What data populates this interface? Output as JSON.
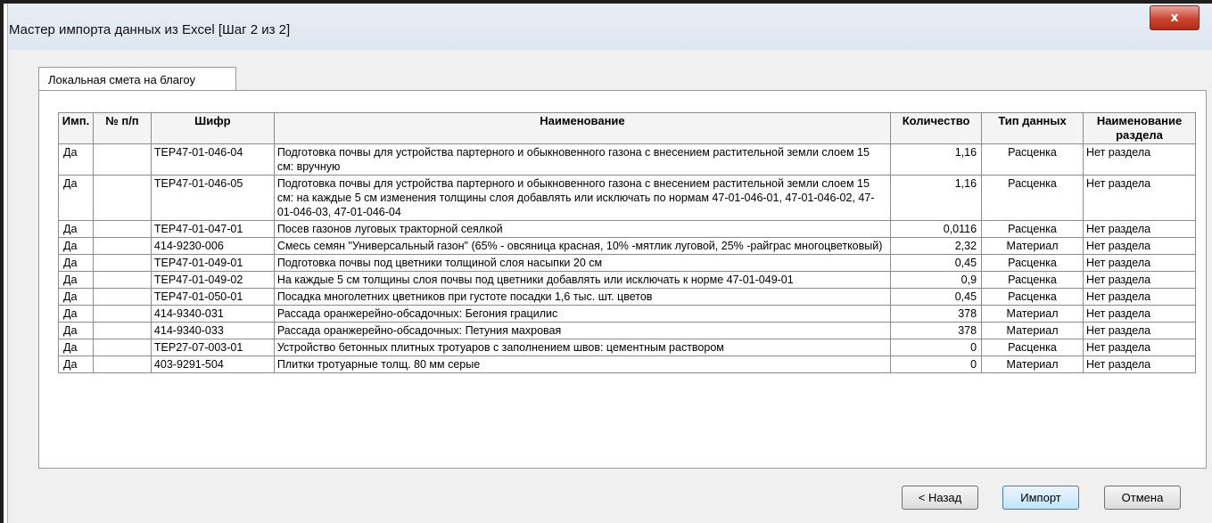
{
  "window": {
    "title": "Мастер импорта данных из Excel [Шаг 2 из 2]",
    "close_label": "x"
  },
  "tab": {
    "label": "Локальная смета на благоу"
  },
  "table": {
    "headers": {
      "imp": "Имп.",
      "num": "№ п/п",
      "code": "Шифр",
      "name": "Наименование",
      "qty": "Количество",
      "type": "Тип данных",
      "section": "Наименование раздела"
    },
    "rows": [
      {
        "imp": "Да",
        "num": "",
        "code": "ТЕР47-01-046-04",
        "name": "Подготовка почвы для устройства партерного и обыкновенного газона с внесением растительной земли слоем 15 см: вручную",
        "qty": "1,16",
        "type": "Расценка",
        "section": "Нет раздела"
      },
      {
        "imp": "Да",
        "num": "",
        "code": "ТЕР47-01-046-05",
        "name": "Подготовка почвы для устройства партерного и обыкновенного газона с внесением растительной земли слоем 15 см: на каждые 5 см изменения толщины слоя добавлять или исключать по нормам 47-01-046-01, 47-01-046-02, 47-01-046-03, 47-01-046-04",
        "qty": "1,16",
        "type": "Расценка",
        "section": "Нет раздела"
      },
      {
        "imp": "Да",
        "num": "",
        "code": "ТЕР47-01-047-01",
        "name": "Посев газонов луговых тракторной сеялкой",
        "qty": "0,0116",
        "type": "Расценка",
        "section": "Нет раздела"
      },
      {
        "imp": "Да",
        "num": "",
        "code": "414-9230-006",
        "name": "Смесь семян \"Универсальный газон\" (65% - овсяница красная, 10% -мятлик луговой, 25% -райграс многоцветковый)",
        "qty": "2,32",
        "type": "Материал",
        "section": "Нет раздела"
      },
      {
        "imp": "Да",
        "num": "",
        "code": "ТЕР47-01-049-01",
        "name": "Подготовка почвы под цветники толщиной слоя насыпки 20 см",
        "qty": "0,45",
        "type": "Расценка",
        "section": "Нет раздела"
      },
      {
        "imp": "Да",
        "num": "",
        "code": "ТЕР47-01-049-02",
        "name": "На каждые 5 см толщины слоя почвы под цветники добавлять или исключать к норме 47-01-049-01",
        "qty": "0,9",
        "type": "Расценка",
        "section": "Нет раздела"
      },
      {
        "imp": "Да",
        "num": "",
        "code": "ТЕР47-01-050-01",
        "name": "Посадка многолетних цветников при густоте посадки 1,6 тыс. шт. цветов",
        "qty": "0,45",
        "type": "Расценка",
        "section": "Нет раздела"
      },
      {
        "imp": "Да",
        "num": "",
        "code": "414-9340-031",
        "name": "Рассада оранжерейно-обсадочных: Бегония грацилис",
        "qty": "378",
        "type": "Материал",
        "section": "Нет раздела"
      },
      {
        "imp": "Да",
        "num": "",
        "code": "414-9340-033",
        "name": "Рассада оранжерейно-обсадочных: Петуния махровая",
        "qty": "378",
        "type": "Материал",
        "section": "Нет раздела"
      },
      {
        "imp": "Да",
        "num": "",
        "code": "ТЕР27-07-003-01",
        "name": "Устройство бетонных плитных тротуаров с заполнением швов: цементным раствором",
        "qty": "0",
        "type": "Расценка",
        "section": "Нет раздела"
      },
      {
        "imp": "Да",
        "num": "",
        "code": "403-9291-504",
        "name": "Плитки тротуарные толщ. 80 мм серые",
        "qty": "0",
        "type": "Материал",
        "section": "Нет раздела"
      }
    ]
  },
  "buttons": {
    "back": "< Назад",
    "import": "Импорт",
    "cancel": "Отмена"
  }
}
